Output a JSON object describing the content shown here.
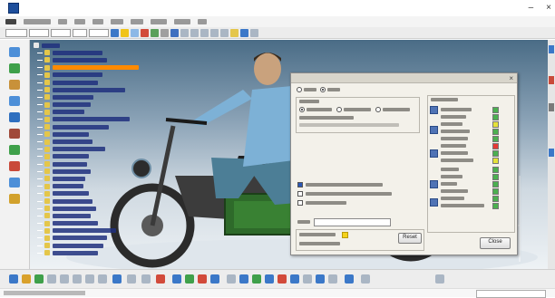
{
  "dialog": {
    "close_label": "Close",
    "reset_label": "Reset"
  },
  "colors": {
    "accent": "#1e4f9c",
    "tree_highlight": "#ff8a00",
    "tree_background": "#20307e",
    "dialog_background": "#f3f1ea"
  },
  "icons": {
    "left_toolbar": [
      "part-icon",
      "shape-icon",
      "assembly-icon",
      "constraint-icon",
      "measure-icon",
      "tree-icon",
      "analysis-icon",
      "material-icon",
      "render-icon",
      "section-icon",
      "move-icon",
      "snap-icon",
      "fit-icon"
    ],
    "bottom_toolbar": [
      "save-icon",
      "undo-icon",
      "redo-icon",
      "zoom-icon",
      "pan-icon",
      "rotate-icon",
      "fit-all-icon",
      "normal-view-icon",
      "hide-show-icon",
      "render-style-icon",
      "measure-icon",
      "graph-icon",
      "filter-icon",
      "clash-icon",
      "section-icon",
      "distance-icon",
      "snapshot-icon",
      "sensor-icon",
      "cog-icon",
      "table-icon",
      "chart-icon",
      "grid-icon",
      "view-icon",
      "light-icon",
      "camera-icon",
      "settings-icon",
      "help-icon"
    ]
  }
}
